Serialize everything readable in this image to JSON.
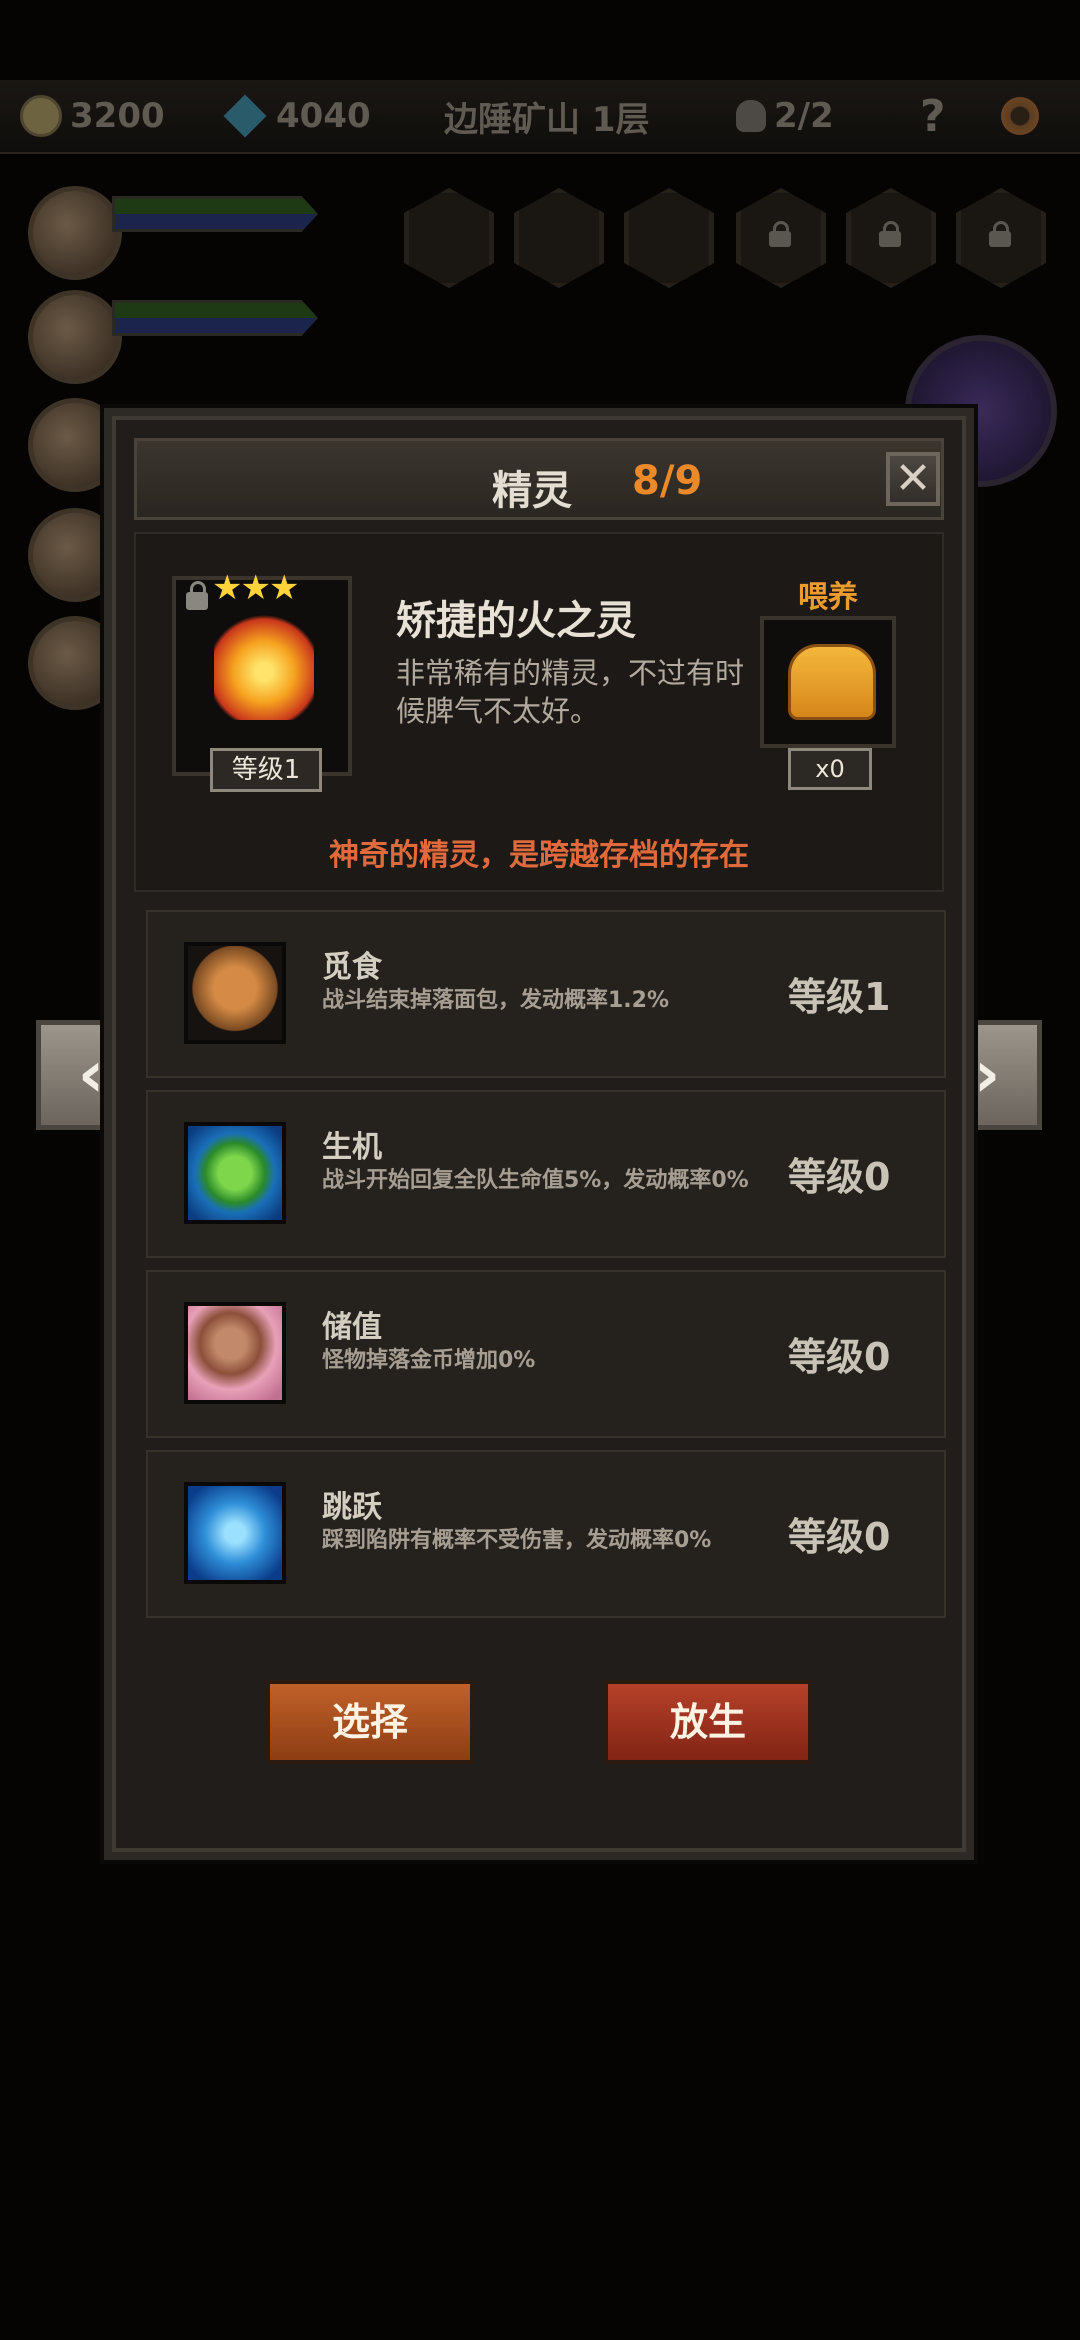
{
  "hud": {
    "gold": "3200",
    "gems": "4040",
    "location": "边陲矿山 1层",
    "skull_count": "2/2",
    "help": "?"
  },
  "modal": {
    "title": "精灵",
    "count": "8/9",
    "close_symbol": "✕"
  },
  "spirit": {
    "stars": "★★★",
    "level": "等级1",
    "name": "矫捷的火之灵",
    "description": "非常稀有的精灵，不过有时候脾气不太好。",
    "feed_label": "喂养",
    "feed_count": "x0",
    "tagline": "神奇的精灵，是跨越存档的存在"
  },
  "skills": [
    {
      "name": "觅食",
      "description": "战斗结束掉落面包，发动概率1.2%",
      "level": "等级1",
      "icon": "gingerbread-icon"
    },
    {
      "name": "生机",
      "description": "战斗开始回复全队生命值5%，发动概率0%",
      "level": "等级0",
      "icon": "leaf-icon"
    },
    {
      "name": "储值",
      "description": "怪物掉落金币增加0%",
      "level": "等级0",
      "icon": "cup-icon"
    },
    {
      "name": "跳跃",
      "description": "踩到陷阱有概率不受伤害，发动概率0%",
      "level": "等级0",
      "icon": "leap-icon"
    }
  ],
  "buttons": {
    "select": "选择",
    "release": "放生",
    "prev": "‹",
    "next": "›"
  },
  "colors": {
    "accent_orange": "#ec8a2a",
    "tagline": "#e06a3b",
    "panel": "#201d1a"
  }
}
